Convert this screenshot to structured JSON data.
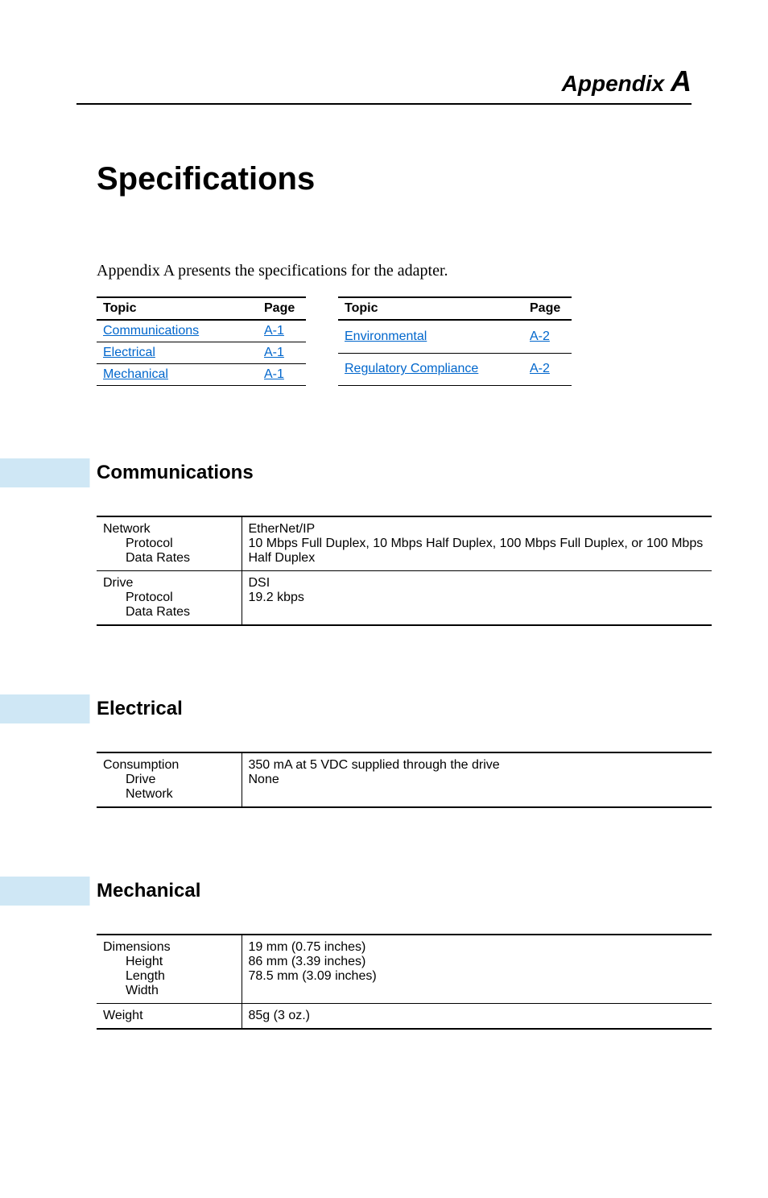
{
  "header": {
    "prefix": "Appendix",
    "letter": "A"
  },
  "title": "Specifications",
  "intro": "Appendix A presents the specifications for the adapter.",
  "toc": {
    "headers": {
      "topic": "Topic",
      "page": "Page"
    },
    "left": [
      {
        "topic": "Communications",
        "page": "A-1"
      },
      {
        "topic": "Electrical",
        "page": "A-1"
      },
      {
        "topic": "Mechanical",
        "page": "A-1"
      }
    ],
    "right": [
      {
        "topic": "Environmental",
        "page": "A-2"
      },
      {
        "topic": "Regulatory Compliance",
        "page": "A-2"
      }
    ]
  },
  "sections": {
    "communications": {
      "title": "Communications",
      "rows": [
        {
          "label": "Network",
          "sub": [
            "Protocol",
            "Data Rates"
          ],
          "value": "EtherNet/IP\n10 Mbps Full Duplex, 10 Mbps Half Duplex, 100 Mbps Full Duplex, or 100 Mbps Half Duplex"
        },
        {
          "label": "Drive",
          "sub": [
            "Protocol",
            "Data Rates"
          ],
          "value": "DSI\n19.2 kbps"
        }
      ]
    },
    "electrical": {
      "title": "Electrical",
      "rows": [
        {
          "label": "Consumption",
          "sub": [
            "Drive",
            "Network"
          ],
          "value": "350 mA at 5 VDC supplied through the drive\nNone"
        }
      ]
    },
    "mechanical": {
      "title": "Mechanical",
      "rows": [
        {
          "label": "Dimensions",
          "sub": [
            "Height",
            "Length",
            "Width"
          ],
          "value": "19 mm (0.75 inches)\n86 mm (3.39 inches)\n78.5 mm (3.09 inches)"
        },
        {
          "label": "Weight",
          "sub": [],
          "value": "85g (3 oz.)"
        }
      ]
    }
  }
}
